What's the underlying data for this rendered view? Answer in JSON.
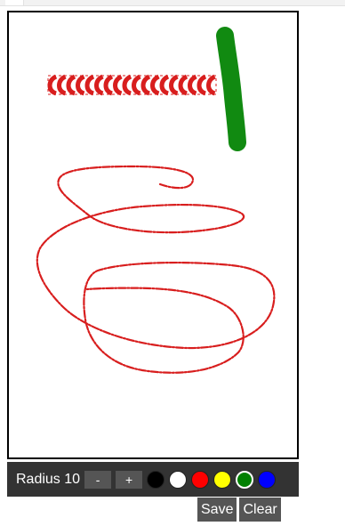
{
  "toolbar": {
    "radius_label": "Radius 10",
    "minus_label": "-",
    "plus_label": "+",
    "colors": [
      {
        "name": "black",
        "hex": "#000000"
      },
      {
        "name": "white",
        "hex": "#ffffff"
      },
      {
        "name": "red",
        "hex": "#ff0000"
      },
      {
        "name": "yellow",
        "hex": "#ffff00"
      },
      {
        "name": "green",
        "hex": "#008000",
        "selected": true
      },
      {
        "name": "blue",
        "hex": "#0000ff"
      }
    ]
  },
  "actions": {
    "save_label": "Save",
    "clear_label": "Clear"
  },
  "drawing": {
    "stroke_colors": {
      "red": "#d81e1e",
      "green": "#118a11"
    }
  }
}
